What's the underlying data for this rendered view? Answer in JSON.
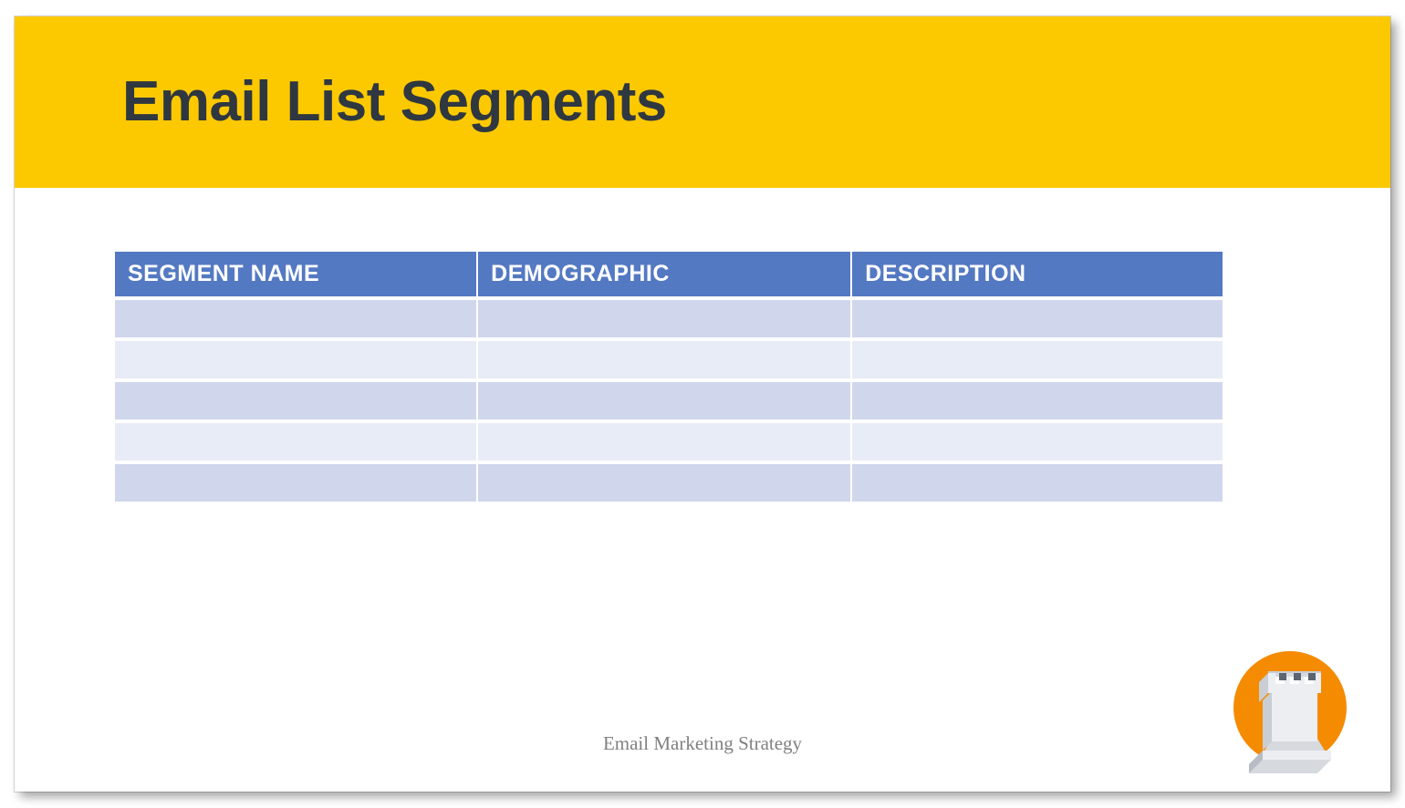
{
  "title": "Email List Segments",
  "table": {
    "headers": [
      "SEGMENT NAME",
      "DEMOGRAPHIC",
      "DESCRIPTION"
    ],
    "rows": [
      {
        "segment": "",
        "demographic": "",
        "description": ""
      },
      {
        "segment": "",
        "demographic": "",
        "description": ""
      },
      {
        "segment": "",
        "demographic": "",
        "description": ""
      },
      {
        "segment": "",
        "demographic": "",
        "description": ""
      },
      {
        "segment": "",
        "demographic": "",
        "description": ""
      }
    ]
  },
  "footer": "Email Marketing Strategy"
}
